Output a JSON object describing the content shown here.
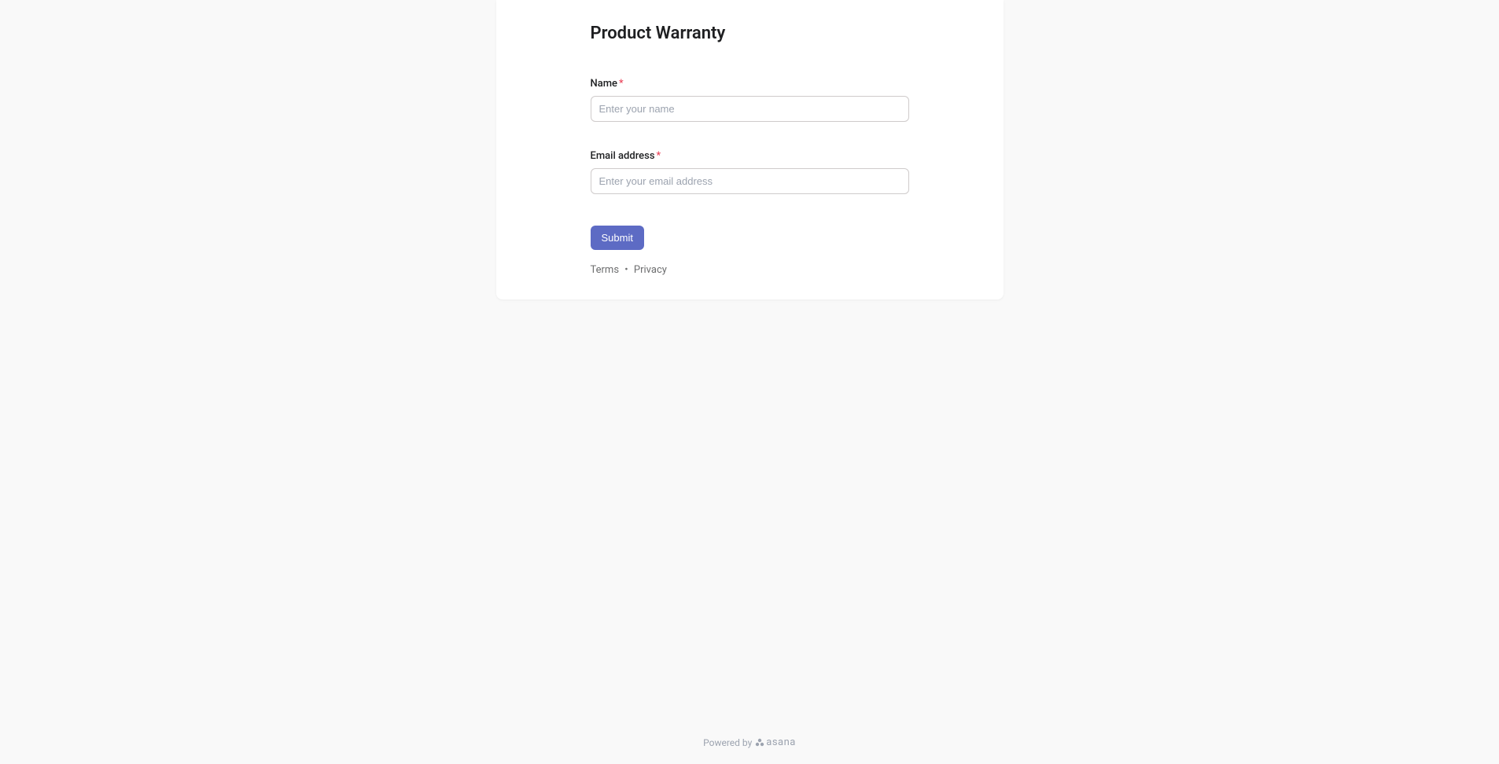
{
  "form": {
    "title": "Product Warranty",
    "fields": {
      "name": {
        "label": "Name",
        "placeholder": "Enter your name",
        "required": true
      },
      "email": {
        "label": "Email address",
        "placeholder": "Enter your email address",
        "required": true
      }
    },
    "submit_label": "Submit"
  },
  "footer": {
    "terms_label": "Terms",
    "privacy_label": "Privacy",
    "separator": "•"
  },
  "powered_by": {
    "text": "Powered by",
    "brand": "asana"
  },
  "required_marker": "*"
}
